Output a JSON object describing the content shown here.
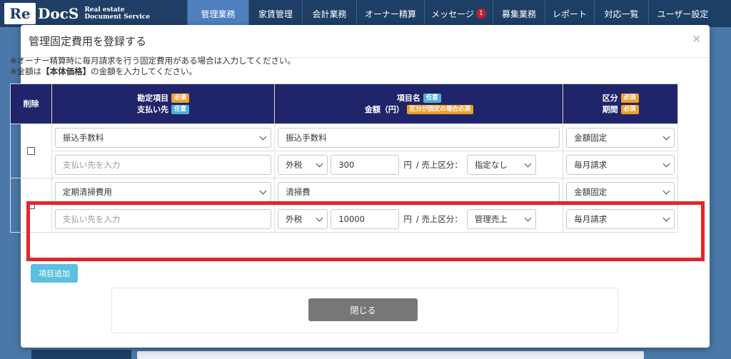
{
  "logo": {
    "re": "Re",
    "docs": "DocS",
    "sub1": "Real estate",
    "sub2": "Document Service"
  },
  "nav": {
    "items": [
      {
        "label": "管理業務",
        "active": true
      },
      {
        "label": "家賃管理"
      },
      {
        "label": "会計業務"
      },
      {
        "label": "オーナー精算"
      },
      {
        "label": "メッセージ",
        "badge": "1"
      },
      {
        "label": "募集業務"
      },
      {
        "label": "レポート"
      },
      {
        "label": "対応一覧"
      },
      {
        "label": "ユーザー設定"
      }
    ]
  },
  "modal": {
    "title": "管理固定費用を登録する",
    "close": "×",
    "note1": "※オーナー精算時に毎月請求を行う固定費用がある場合は入力してください。",
    "note2_pre": "※金額は",
    "note2_bold": "【本体価格】",
    "note2_post": "の金額を入力してください。",
    "headers": {
      "delete": "削除",
      "account": "勘定項目",
      "payee": "支払い先",
      "item_name": "項目名",
      "amount": "金額（円）",
      "category": "区分",
      "period": "期間",
      "req": "必須",
      "opt": "任意",
      "fixed_req": "区分が固定の場合必須"
    },
    "rows": [
      {
        "account": "振込手数料",
        "item_name": "振込手数料",
        "category": "金額固定",
        "payee_placeholder": "支払い先を入力",
        "tax": "外税",
        "amount": "300",
        "yen": "円",
        "sales_label": "/ 売上区分：",
        "sales": "指定なし",
        "period": "毎月請求"
      },
      {
        "account": "定期清掃費用",
        "item_name": "清掃費",
        "category": "金額固定",
        "payee_placeholder": "支払い先を入力",
        "tax": "外税",
        "amount": "10000",
        "yen": "円",
        "sales_label": "/ 売上区分：",
        "sales": "管理売上",
        "period": "毎月請求"
      }
    ],
    "add_button": "項目追加",
    "close_button": "閉じる"
  },
  "colors": {
    "nav_bg": "#1d3f66",
    "nav_active": "#4d80bd",
    "table_header": "#20246b",
    "highlight": "#e3262b",
    "add_button": "#5bc0de",
    "close_button": "#777777"
  }
}
